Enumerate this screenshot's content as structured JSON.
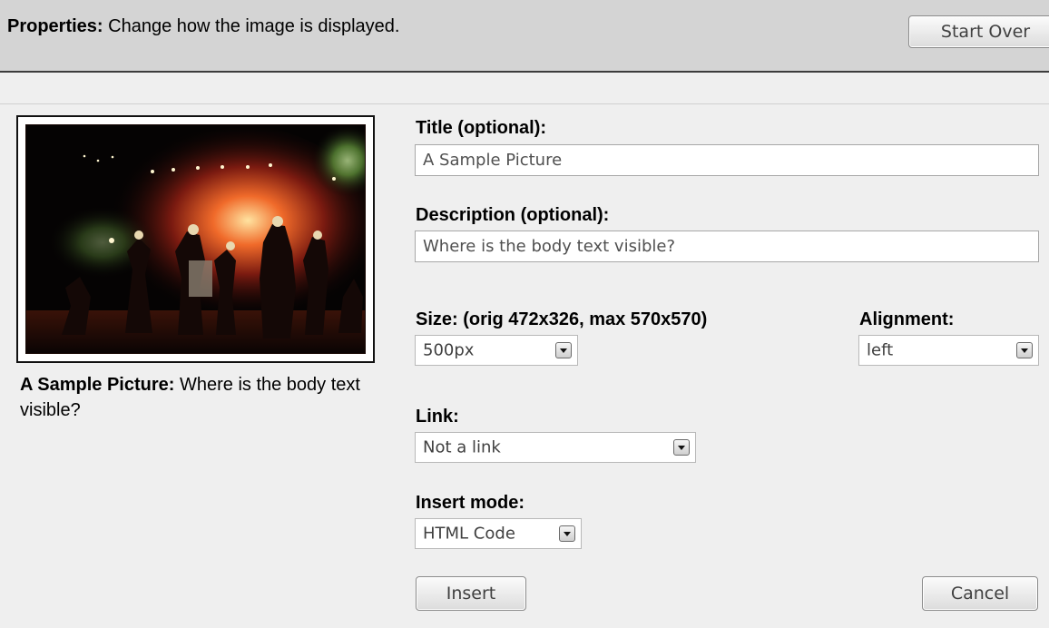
{
  "header": {
    "label": "Properties:",
    "description": "Change how the image is displayed.",
    "start_over": "Start Over"
  },
  "preview": {
    "caption_title": "A Sample Picture:",
    "caption_body": "Where is the body text visible?"
  },
  "form": {
    "title_label": "Title (optional):",
    "title_value": "A Sample Picture",
    "description_label": "Description (optional):",
    "description_value": "Where is the body text visible?",
    "size_label": "Size: (orig 472x326, max 570x570)",
    "size_value": "500px",
    "alignment_label": "Alignment:",
    "alignment_value": "left",
    "link_label": "Link:",
    "link_value": "Not a link",
    "insert_mode_label": "Insert mode:",
    "insert_mode_value": "HTML Code",
    "insert_button": "Insert",
    "cancel_button": "Cancel"
  }
}
